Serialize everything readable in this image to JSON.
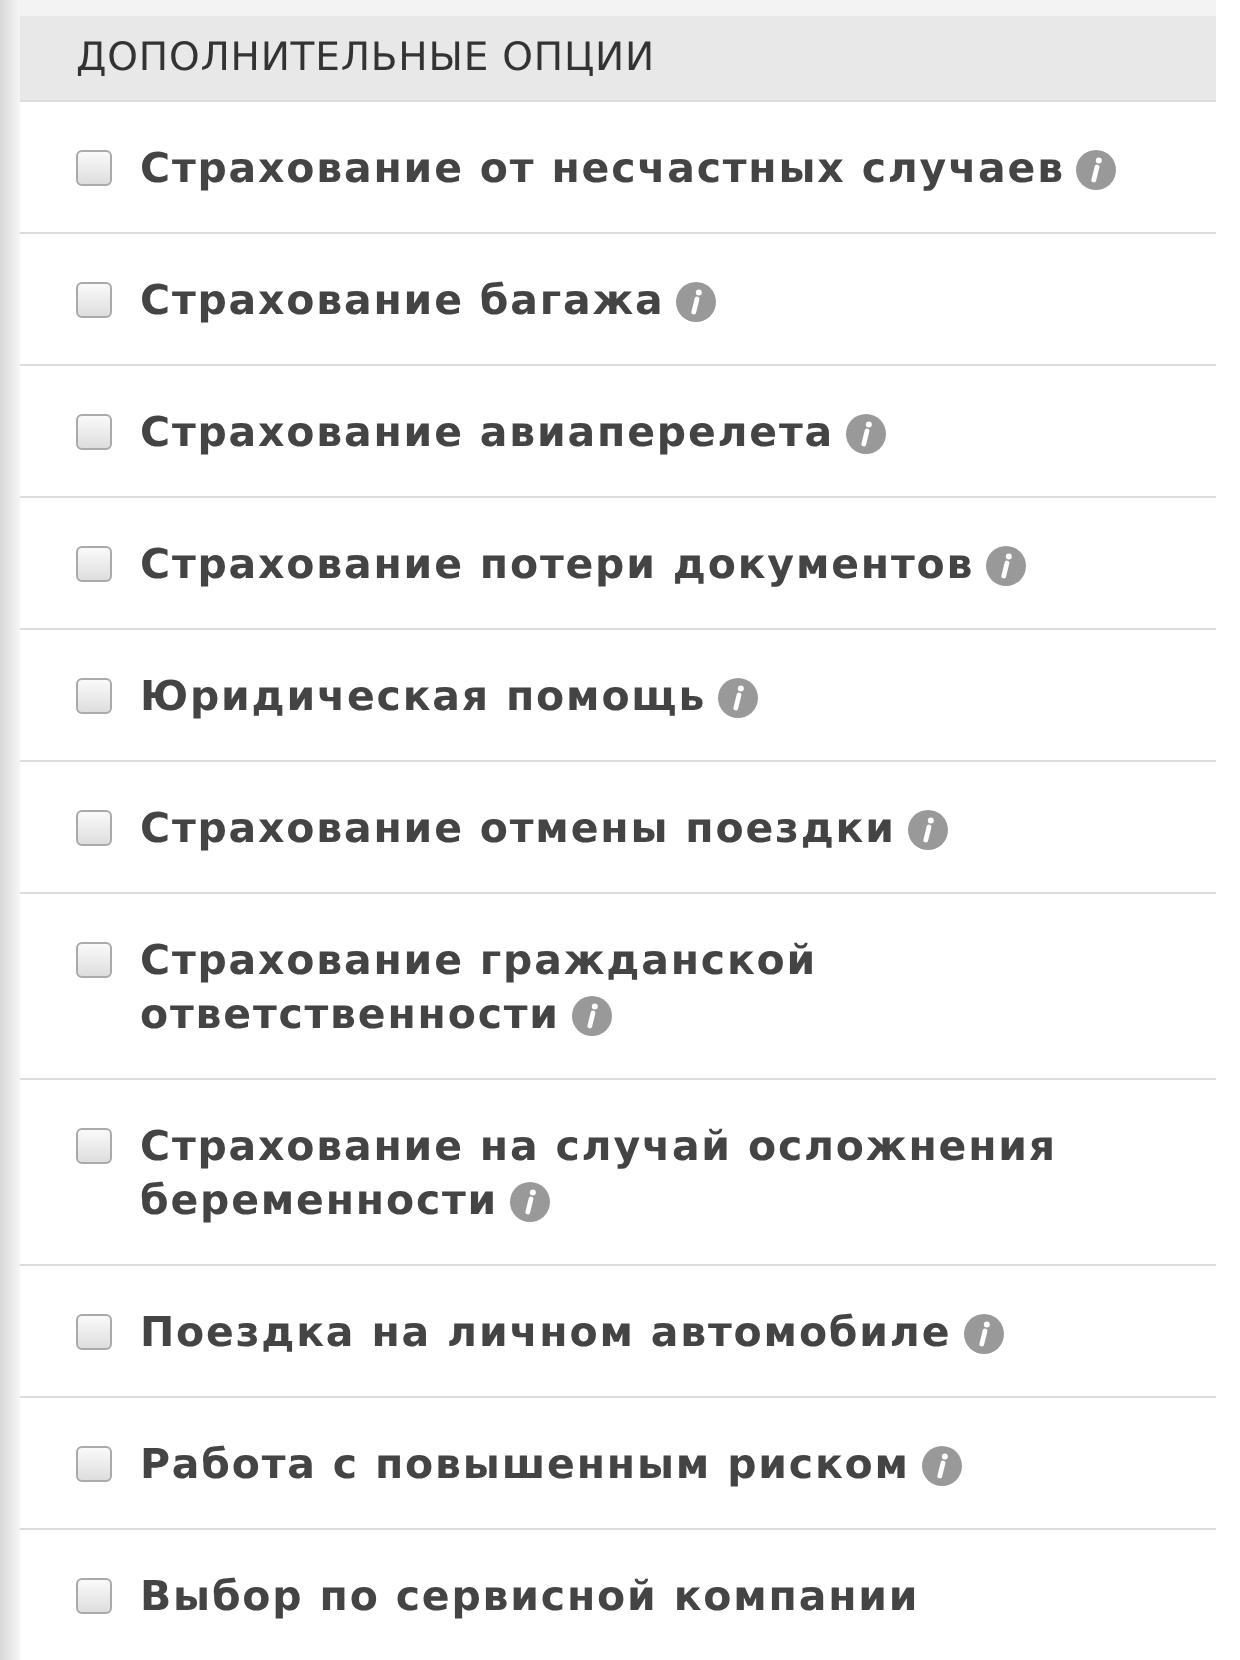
{
  "section": {
    "title": "ДОПОЛНИТЕЛЬНЫЕ ОПЦИИ"
  },
  "options": [
    {
      "lines": [
        "Страхование от несчастных случаев"
      ],
      "checked": false,
      "info": true
    },
    {
      "lines": [
        "Страхование багажа"
      ],
      "checked": false,
      "info": true
    },
    {
      "lines": [
        "Страхование авиаперелета"
      ],
      "checked": false,
      "info": true
    },
    {
      "lines": [
        "Страхование потери документов"
      ],
      "checked": false,
      "info": true
    },
    {
      "lines": [
        "Юридическая помощь"
      ],
      "checked": false,
      "info": true
    },
    {
      "lines": [
        "Страхование отмены поездки"
      ],
      "checked": false,
      "info": true
    },
    {
      "lines": [
        "Страхование гражданской",
        "ответственности"
      ],
      "checked": false,
      "info": true
    },
    {
      "lines": [
        "Страхование на случай осложнения",
        "беременности"
      ],
      "checked": false,
      "info": true
    },
    {
      "lines": [
        "Поездка на личном автомобиле"
      ],
      "checked": false,
      "info": true
    },
    {
      "lines": [
        "Работа с повышенным риском"
      ],
      "checked": false,
      "info": true
    },
    {
      "lines": [
        "Выбор по сервисной компании"
      ],
      "checked": false,
      "info": false
    }
  ]
}
